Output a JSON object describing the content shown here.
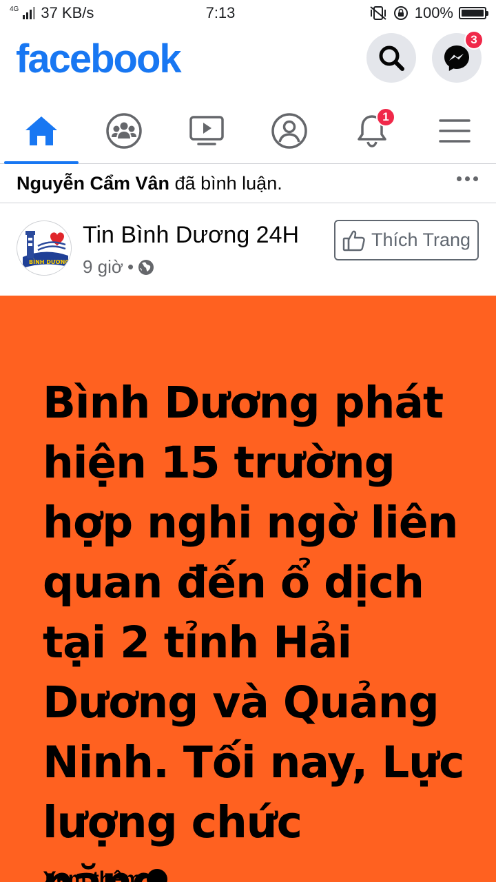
{
  "status_bar": {
    "network": "4G",
    "speed": "37 KB/s",
    "time": "7:13",
    "battery": "100%"
  },
  "header": {
    "logo": "facebook",
    "messenger_badge": "3"
  },
  "nav": {
    "tabs": [
      {
        "name": "home-tab",
        "icon": "home-icon",
        "active": true
      },
      {
        "name": "groups-tab",
        "icon": "groups-icon",
        "active": false
      },
      {
        "name": "watch-tab",
        "icon": "video-icon",
        "active": false
      },
      {
        "name": "profile-tab",
        "icon": "profile-icon",
        "active": false
      },
      {
        "name": "notifications-tab",
        "icon": "bell-icon",
        "active": false
      },
      {
        "name": "menu-tab",
        "icon": "hamburger-icon",
        "active": false
      }
    ],
    "notifications_badge": "1"
  },
  "activity": {
    "actor": "Nguyễn Cẩm Vân",
    "action": "đã bình luận."
  },
  "post": {
    "page_name": "Tin Bình Dương 24H",
    "time": "9 giờ",
    "separator": "•",
    "like_page_label": "Thích Trang",
    "avatar_text": "BÌNH DƯƠNG",
    "text": "Bình Dương phát hiện 15 trường hợp nghi ngờ liên quan đến ổ dịch tại 2 tỉnh Hải Dương và Quảng Ninh. Tối nay, Lực lượng chức năng...",
    "see_more": "Xem thêm",
    "background_color": "#ff6120"
  },
  "colors": {
    "brand": "#1877f2",
    "badge": "#f02849"
  }
}
